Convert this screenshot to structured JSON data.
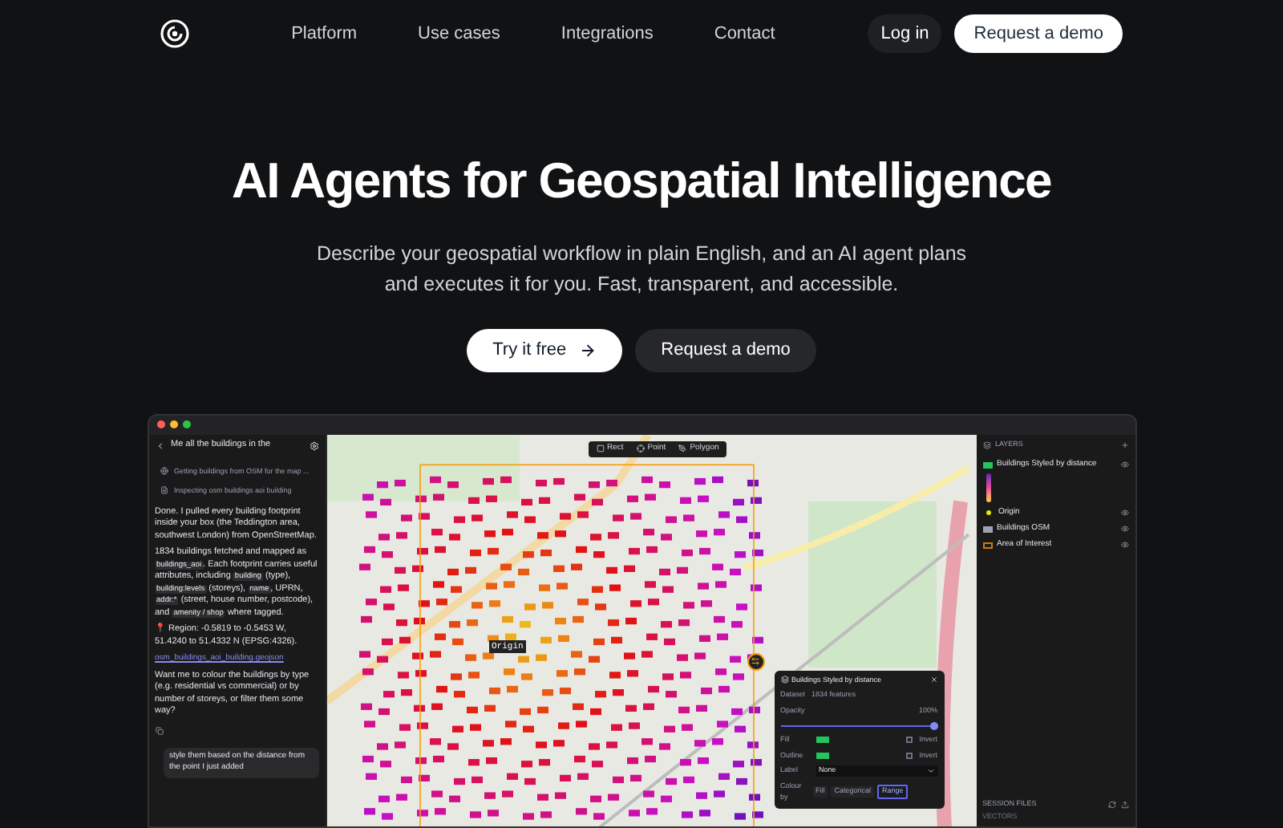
{
  "nav": {
    "links": [
      "Platform",
      "Use cases",
      "Integrations",
      "Contact"
    ],
    "login": "Log in",
    "cta": "Request a demo"
  },
  "hero": {
    "title": "AI Agents for Geospatial Intelligence",
    "subtitle": "Describe your geospatial workflow in plain English, and an AI agent plans and executes it for you. Fast, transparent, and accessible.",
    "primary": "Try it free",
    "secondary": "Request a demo"
  },
  "app": {
    "chat": {
      "title": "Me all the buildings in the",
      "steps": [
        "Getting buildings from OSM for the map ...",
        "Inspecting osm buildings aoi building"
      ],
      "paragraphs": [
        [
          {
            "text": "Done. I pulled every building footprint inside your box (the Teddington area, southwest London) from ",
            "code": false
          },
          {
            "text": "OpenStreetMap.",
            "code": false
          }
        ],
        [
          {
            "text": "1834 buildings fetched and mapped as ",
            "code": false
          },
          {
            "text": "buildings_aoi",
            "code": true
          },
          {
            "text": ". Each footprint carries useful attributes, including ",
            "code": false
          },
          {
            "text": "building",
            "code": true
          },
          {
            "text": " (type), ",
            "code": false
          },
          {
            "text": "building:levels",
            "code": true
          },
          {
            "text": " (storeys), ",
            "code": false
          },
          {
            "text": "name",
            "code": true
          },
          {
            "text": ", UPRN, ",
            "code": false
          },
          {
            "text": "addr:*",
            "code": true
          },
          {
            "text": " (street, house number, postcode), and ",
            "code": false
          },
          {
            "text": "amenity / shop",
            "code": true
          },
          {
            "text": " where tagged.",
            "code": false
          }
        ],
        [
          {
            "text": "📍 Region: -0.5819 to -0.5453 W, 51.4240 to 51.4332 N (EPSG:4326).",
            "code": false
          }
        ]
      ],
      "file_link": "osm_buildings_aoi_building.geojson",
      "question": "Want me to colour the buildings by type (e.g. residential vs commercial) or by number of storeys, or filter them some way?",
      "user_message": "style them based on the distance from the point I just added"
    },
    "map": {
      "tools": [
        "Rect",
        "Point",
        "Polygon"
      ],
      "marker": "Origin",
      "panel": {
        "title": "Buildings Styled by distance",
        "dataset_label": "Dataset",
        "dataset": "1834 features",
        "opacity_label": "Opacity",
        "opacity": "100%",
        "level": 1,
        "rows": [
          {
            "label": "Fill",
            "color": "#22c55e",
            "option": "Invert",
            "checked": false
          },
          {
            "label": "Outline",
            "color": "#22c55e",
            "option": "Invert",
            "checked": false
          }
        ],
        "label_label": "Label",
        "label_value": "None",
        "colour_by_label": "Colour by",
        "colour_by": [
          {
            "label": "Fill",
            "selected": false
          },
          {
            "label": "Categorical",
            "selected": false
          },
          {
            "label": "Range",
            "selected": true
          }
        ]
      }
    },
    "layers": {
      "title": "LAYERS",
      "items": [
        {
          "name": "Buildings Styled by distance",
          "kind": "gradient",
          "color": "#22c55e"
        },
        {
          "name": "Origin",
          "kind": "point",
          "color": "#e5e510"
        },
        {
          "name": "Buildings OSM",
          "kind": "fill",
          "color": "#9ca3af"
        },
        {
          "name": "Area of Interest",
          "kind": "outline",
          "color": "#d97706"
        }
      ],
      "session_files": "SESSION FILES",
      "vectors": "VECTORS"
    }
  }
}
